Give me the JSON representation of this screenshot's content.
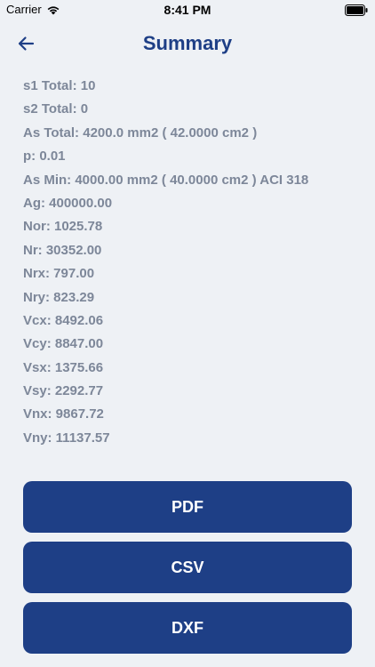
{
  "status_bar": {
    "carrier": "Carrier",
    "time": "8:41 PM"
  },
  "nav": {
    "title": "Summary",
    "back_icon": "arrow-left-icon"
  },
  "summary": {
    "items": [
      "s1 Total: 10",
      "s2 Total: 0",
      "As Total: 4200.0 mm2 ( 42.0000 cm2 )",
      "p: 0.01",
      "As Min: 4000.00 mm2 ( 40.0000 cm2 ) ACI 318",
      "Ag: 400000.00",
      "Nor: 1025.78",
      "Nr: 30352.00",
      "Nrx: 797.00",
      "Nry: 823.29",
      "Vcx: 8492.06",
      "Vcy: 8847.00",
      "Vsx: 1375.66",
      "Vsy: 2292.77",
      "Vnx: 9867.72",
      "Vny: 11137.57"
    ]
  },
  "buttons": {
    "pdf": "PDF",
    "csv": "CSV",
    "dxf": "DXF"
  },
  "colors": {
    "accent": "#1e3f86",
    "background": "#eef1f5",
    "text_muted": "#7d8799"
  }
}
